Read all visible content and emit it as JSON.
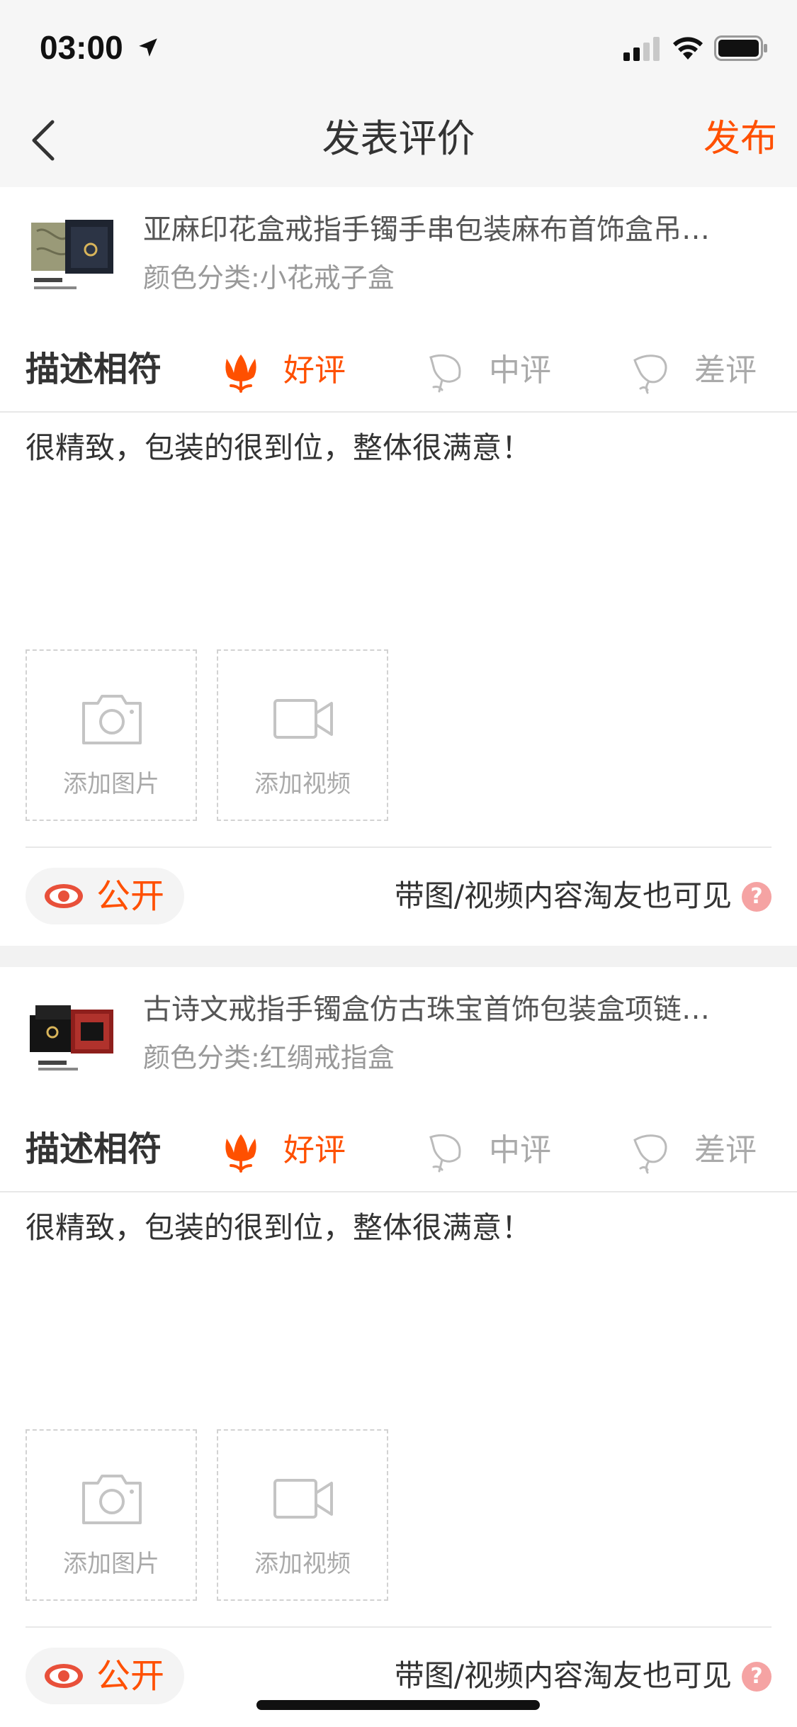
{
  "status_bar": {
    "time": "03:00",
    "icons": [
      "location-arrow-icon",
      "cellular-signal-icon",
      "wifi-icon",
      "battery-icon"
    ]
  },
  "nav": {
    "title": "发表评价",
    "publish_label": "发布",
    "back_icon": "chevron-left-icon"
  },
  "colors": {
    "accent": "#ff5000",
    "muted": "#aaaaaa",
    "background": "#f6f6f6",
    "help": "#f5a3a3"
  },
  "reviews": [
    {
      "product_title": "亚麻印花盒戒指手镯手串包装麻布首饰盒吊…",
      "sku": "颜色分类:小花戒子盒",
      "rating_label": "描述相符",
      "ratings": [
        {
          "label": "好评",
          "icon": "flower-good-icon",
          "selected": true
        },
        {
          "label": "中评",
          "icon": "flower-neutral-icon",
          "selected": false
        },
        {
          "label": "差评",
          "icon": "flower-bad-icon",
          "selected": false
        }
      ],
      "text": "很精致，包装的很到位，整体很满意！",
      "add_photo": "添加图片",
      "add_video": "添加视频",
      "public_label": "公开",
      "visibility_note": "带图/视频内容淘友也可见",
      "help": "?"
    },
    {
      "product_title": "古诗文戒指手镯盒仿古珠宝首饰包装盒项链…",
      "sku": "颜色分类:红绸戒指盒",
      "rating_label": "描述相符",
      "ratings": [
        {
          "label": "好评",
          "icon": "flower-good-icon",
          "selected": true
        },
        {
          "label": "中评",
          "icon": "flower-neutral-icon",
          "selected": false
        },
        {
          "label": "差评",
          "icon": "flower-bad-icon",
          "selected": false
        }
      ],
      "text": "很精致，包装的很到位，整体很满意！",
      "add_photo": "添加图片",
      "add_video": "添加视频",
      "public_label": "公开",
      "visibility_note": "带图/视频内容淘友也可见",
      "help": "?"
    }
  ]
}
